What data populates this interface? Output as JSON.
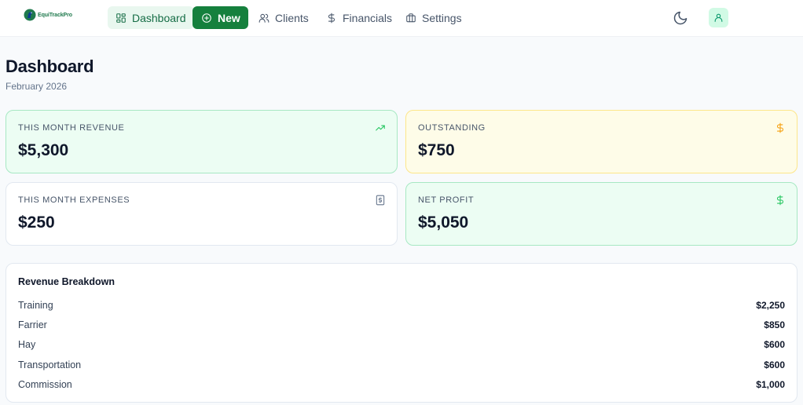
{
  "brand": {
    "name": "EquiTrackPro"
  },
  "nav": {
    "items": [
      {
        "label": "Dashboard",
        "icon": "dashboard-icon"
      },
      {
        "label": "New",
        "icon": "plus-circle-icon"
      },
      {
        "label": "Clients",
        "icon": "users-icon"
      },
      {
        "label": "Financials",
        "icon": "dollar-icon"
      },
      {
        "label": "Settings",
        "icon": "briefcase-icon"
      }
    ]
  },
  "header": {
    "title": "Dashboard",
    "subtitle": "February 2026"
  },
  "stats": [
    {
      "label": "THIS MONTH REVENUE",
      "value": "$5,300",
      "icon": "trending-up-icon",
      "color": "#22c55e"
    },
    {
      "label": "OUTSTANDING",
      "value": "$750",
      "icon": "dollar-icon",
      "color": "#f59e0b"
    },
    {
      "label": "THIS MONTH EXPENSES",
      "value": "$250",
      "icon": "receipt-icon",
      "color": "#64748b"
    },
    {
      "label": "NET PROFIT",
      "value": "$5,050",
      "icon": "dollar-icon",
      "color": "#22c55e"
    }
  ],
  "breakdown": {
    "title": "Revenue Breakdown",
    "rows": [
      {
        "label": "Training",
        "value": "$2,250"
      },
      {
        "label": "Farrier",
        "value": "$850"
      },
      {
        "label": "Hay",
        "value": "$600"
      },
      {
        "label": "Transportation",
        "value": "$600"
      },
      {
        "label": "Commission",
        "value": "$1,000"
      }
    ]
  },
  "colors": {
    "accent": "#15803d",
    "accent_soft": "#e9f7ef",
    "positive_bg": "#ecfdf3",
    "warning_bg": "#fefce8"
  }
}
